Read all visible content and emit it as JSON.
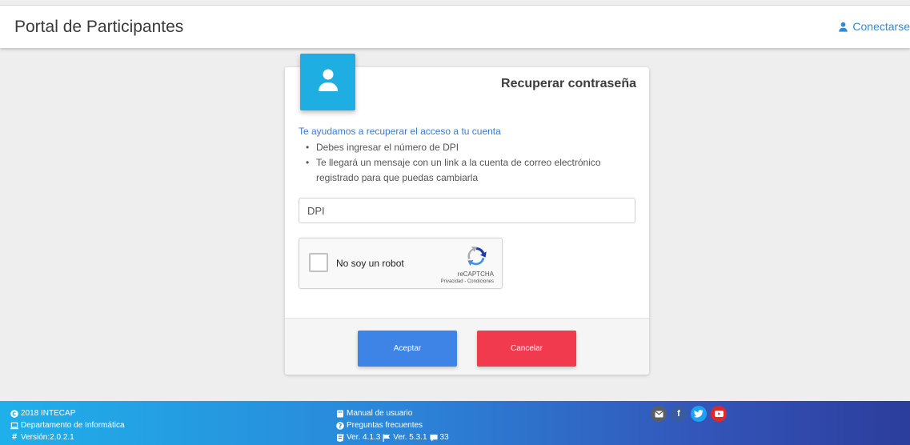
{
  "header": {
    "title": "Portal de Participantes",
    "connect_label": "Conectarse"
  },
  "card": {
    "title": "Recuperar contraseña",
    "subtitle": "Te ayudamos a recuperar el acceso a tu cuenta",
    "bullets": [
      "Debes ingresar el número de DPI",
      "Te llegará un mensaje con un link a la cuenta de correo electrónico registrado para que puedas cambiarla"
    ],
    "dpi_placeholder": "DPI",
    "dpi_value": "",
    "recaptcha": {
      "label": "No soy un robot",
      "brand": "reCAPTCHA",
      "terms": "Privacidad - Condiciones"
    },
    "accept_label": "Aceptar",
    "cancel_label": "Cancelar"
  },
  "footer": {
    "left": {
      "copyright": "2018 INTECAP",
      "department": "Departamento de Informática",
      "version": "Versión:2.0.2.1"
    },
    "middle": {
      "manual": "Manual de usuario",
      "faq": "Preguntas frecuentes",
      "ver_a": "Ver. 4.1.3",
      "ver_b": "Ver. 5.3.1",
      "count": "33"
    },
    "social_icons": [
      "mail-icon",
      "facebook-icon",
      "twitter-icon",
      "youtube-icon"
    ]
  },
  "colors": {
    "accent_blue": "#1eaee1",
    "accept": "#3d84e6",
    "cancel": "#f23a4f",
    "link": "#3a7bd5"
  }
}
